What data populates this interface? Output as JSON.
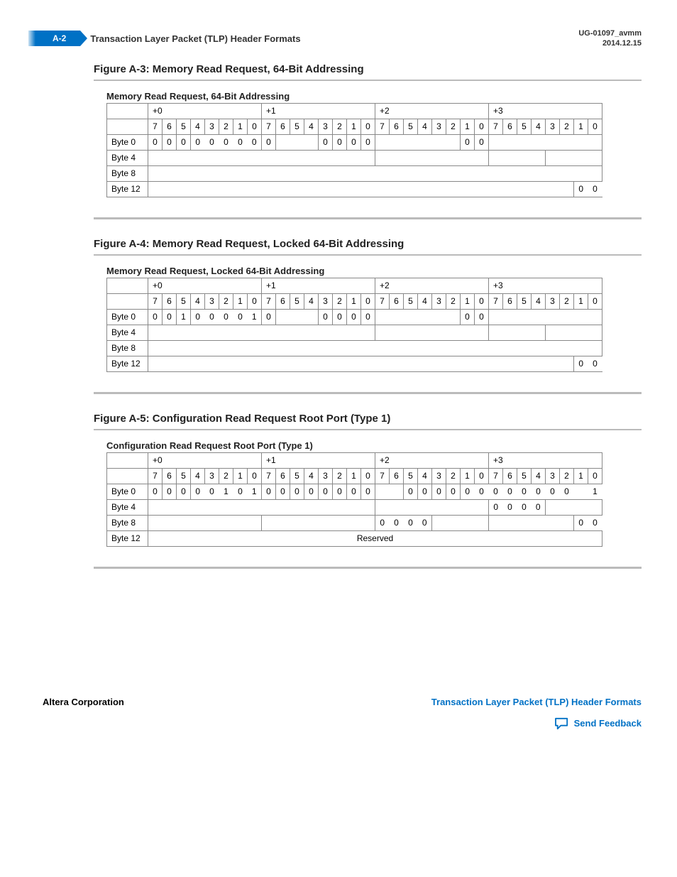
{
  "header": {
    "page_number": "A-2",
    "title": "Transaction Layer Packet (TLP) Header Formats",
    "doc_id": "UG-01097_avmm",
    "date": "2014.12.15"
  },
  "figures": [
    {
      "id": "A-3",
      "heading": "Figure A-3: Memory Read Request, 64-Bit Addressing",
      "caption": "Memory Read Request, 64-Bit Addressing",
      "offsets": [
        "+0",
        "+1",
        "+2",
        "+3"
      ],
      "bit_labels": [
        "7",
        "6",
        "5",
        "4",
        "3",
        "2",
        "1",
        "0",
        "7",
        "6",
        "5",
        "4",
        "3",
        "2",
        "1",
        "0",
        "7",
        "6",
        "5",
        "4",
        "3",
        "2",
        "1",
        "0",
        "7",
        "6",
        "5",
        "4",
        "3",
        "2",
        "1",
        "0"
      ],
      "rows": [
        {
          "label": "Byte 0",
          "cells": [
            {
              "t": "0"
            },
            {
              "t": "0"
            },
            {
              "t": "0"
            },
            {
              "t": "0",
              "nb": true
            },
            {
              "t": "0",
              "nb": true
            },
            {
              "t": "0",
              "nb": true
            },
            {
              "t": "0",
              "nb": true
            },
            {
              "t": "0",
              "nb": true
            },
            {
              "t": "0"
            },
            {
              "span": 3,
              "t": ""
            },
            {
              "t": "0"
            },
            {
              "t": "0"
            },
            {
              "t": "0"
            },
            {
              "t": "0"
            },
            {
              "span": 6,
              "t": ""
            },
            {
              "t": "0"
            },
            {
              "t": "0"
            },
            {
              "span": 8,
              "t": ""
            }
          ]
        },
        {
          "label": "Byte 4",
          "cells": [
            {
              "span": 16,
              "t": ""
            },
            {
              "span": 8,
              "t": ""
            },
            {
              "span": 4,
              "t": ""
            },
            {
              "span": 4,
              "t": ""
            }
          ]
        },
        {
          "label": "Byte 8",
          "cells": [
            {
              "span": 32,
              "t": ""
            }
          ]
        },
        {
          "label": "Byte 12",
          "cells": [
            {
              "span": 30,
              "t": ""
            },
            {
              "t": "0",
              "nb": true
            },
            {
              "t": "0",
              "nb": true
            }
          ]
        }
      ]
    },
    {
      "id": "A-4",
      "heading": "Figure A-4: Memory Read Request, Locked 64-Bit Addressing",
      "caption": "Memory Read Request, Locked 64-Bit Addressing",
      "offsets": [
        "+0",
        "+1",
        "+2",
        "+3"
      ],
      "bit_labels": [
        "7",
        "6",
        "5",
        "4",
        "3",
        "2",
        "1",
        "0",
        "7",
        "6",
        "5",
        "4",
        "3",
        "2",
        "1",
        "0",
        "7",
        "6",
        "5",
        "4",
        "3",
        "2",
        "1",
        "0",
        "7",
        "6",
        "5",
        "4",
        "3",
        "2",
        "1",
        "0"
      ],
      "rows": [
        {
          "label": "Byte 0",
          "cells": [
            {
              "t": "0"
            },
            {
              "t": "0"
            },
            {
              "t": "1"
            },
            {
              "t": "0",
              "nb": true
            },
            {
              "t": "0",
              "nb": true
            },
            {
              "t": "0",
              "nb": true
            },
            {
              "t": "0",
              "nb": true
            },
            {
              "t": "1",
              "nb": true
            },
            {
              "t": "0"
            },
            {
              "span": 3,
              "t": ""
            },
            {
              "t": "0"
            },
            {
              "t": "0"
            },
            {
              "t": "0"
            },
            {
              "t": "0"
            },
            {
              "span": 6,
              "t": ""
            },
            {
              "t": "0"
            },
            {
              "t": "0"
            },
            {
              "span": 8,
              "t": ""
            }
          ]
        },
        {
          "label": "Byte 4",
          "cells": [
            {
              "span": 16,
              "t": ""
            },
            {
              "span": 8,
              "t": ""
            },
            {
              "span": 4,
              "t": ""
            },
            {
              "span": 4,
              "t": ""
            }
          ]
        },
        {
          "label": "Byte 8",
          "cells": [
            {
              "span": 32,
              "t": ""
            }
          ]
        },
        {
          "label": "Byte 12",
          "cells": [
            {
              "span": 30,
              "t": ""
            },
            {
              "t": "0",
              "nb": true
            },
            {
              "t": "0",
              "nb": true
            }
          ]
        }
      ]
    },
    {
      "id": "A-5",
      "heading": "Figure A-5: Configuration Read Request Root Port (Type 1)",
      "caption": "Configuration Read Request Root Port (Type 1)",
      "offsets": [
        "+0",
        "+1",
        "+2",
        "+3"
      ],
      "bit_labels": [
        "7",
        "6",
        "5",
        "4",
        "3",
        "2",
        "1",
        "0",
        "7",
        "6",
        "5",
        "4",
        "3",
        "2",
        "1",
        "0",
        "7",
        "6",
        "5",
        "4",
        "3",
        "2",
        "1",
        "0",
        "7",
        "6",
        "5",
        "4",
        "3",
        "2",
        "1",
        "0"
      ],
      "rows": [
        {
          "label": "Byte 0",
          "cells": [
            {
              "t": "0"
            },
            {
              "t": "0"
            },
            {
              "t": "0"
            },
            {
              "t": "0",
              "nb": true
            },
            {
              "t": "0",
              "nb": true
            },
            {
              "t": "1",
              "nb": true
            },
            {
              "t": "0",
              "nb": true
            },
            {
              "t": "1",
              "nb": true
            },
            {
              "t": "0"
            },
            {
              "t": "0"
            },
            {
              "t": "0"
            },
            {
              "t": "0"
            },
            {
              "t": "0"
            },
            {
              "t": "0"
            },
            {
              "t": "0"
            },
            {
              "t": "0"
            },
            {
              "span": 2,
              "t": ""
            },
            {
              "t": "0"
            },
            {
              "t": "0"
            },
            {
              "t": "0"
            },
            {
              "t": "0"
            },
            {
              "t": "0",
              "nb": true
            },
            {
              "t": "0",
              "nb": true
            },
            {
              "t": "0",
              "nb": true
            },
            {
              "t": "0",
              "nb": true
            },
            {
              "t": "0",
              "nb": true
            },
            {
              "t": "0",
              "nb": true
            },
            {
              "t": "0",
              "nb": true
            },
            {
              "t": "0",
              "nb": true
            },
            {
              "t": "",
              "nb": true
            },
            {
              "t": "1",
              "nb": true
            }
          ]
        },
        {
          "label": "Byte 4",
          "cells": [
            {
              "span": 16,
              "t": ""
            },
            {
              "span": 8,
              "t": ""
            },
            {
              "t": "0",
              "nb": true
            },
            {
              "t": "0",
              "nb": true
            },
            {
              "t": "0",
              "nb": true
            },
            {
              "t": "0",
              "nb": true
            },
            {
              "span": 4,
              "t": ""
            }
          ]
        },
        {
          "label": "Byte 8",
          "cells": [
            {
              "span": 8,
              "t": ""
            },
            {
              "span": 8,
              "t": ""
            },
            {
              "t": "0",
              "nb": true
            },
            {
              "t": "0",
              "nb": true
            },
            {
              "t": "0",
              "nb": true
            },
            {
              "t": "0",
              "nb": true
            },
            {
              "span": 4,
              "t": ""
            },
            {
              "span": 6,
              "t": ""
            },
            {
              "t": "0",
              "nb": true
            },
            {
              "t": "0",
              "nb": true
            }
          ]
        },
        {
          "label": "Byte 12",
          "cells": [
            {
              "span": 32,
              "t": "Reserved"
            }
          ]
        }
      ]
    }
  ],
  "footer": {
    "left": "Altera Corporation",
    "right_link": "Transaction Layer Packet (TLP) Header Formats",
    "feedback": "Send Feedback"
  }
}
